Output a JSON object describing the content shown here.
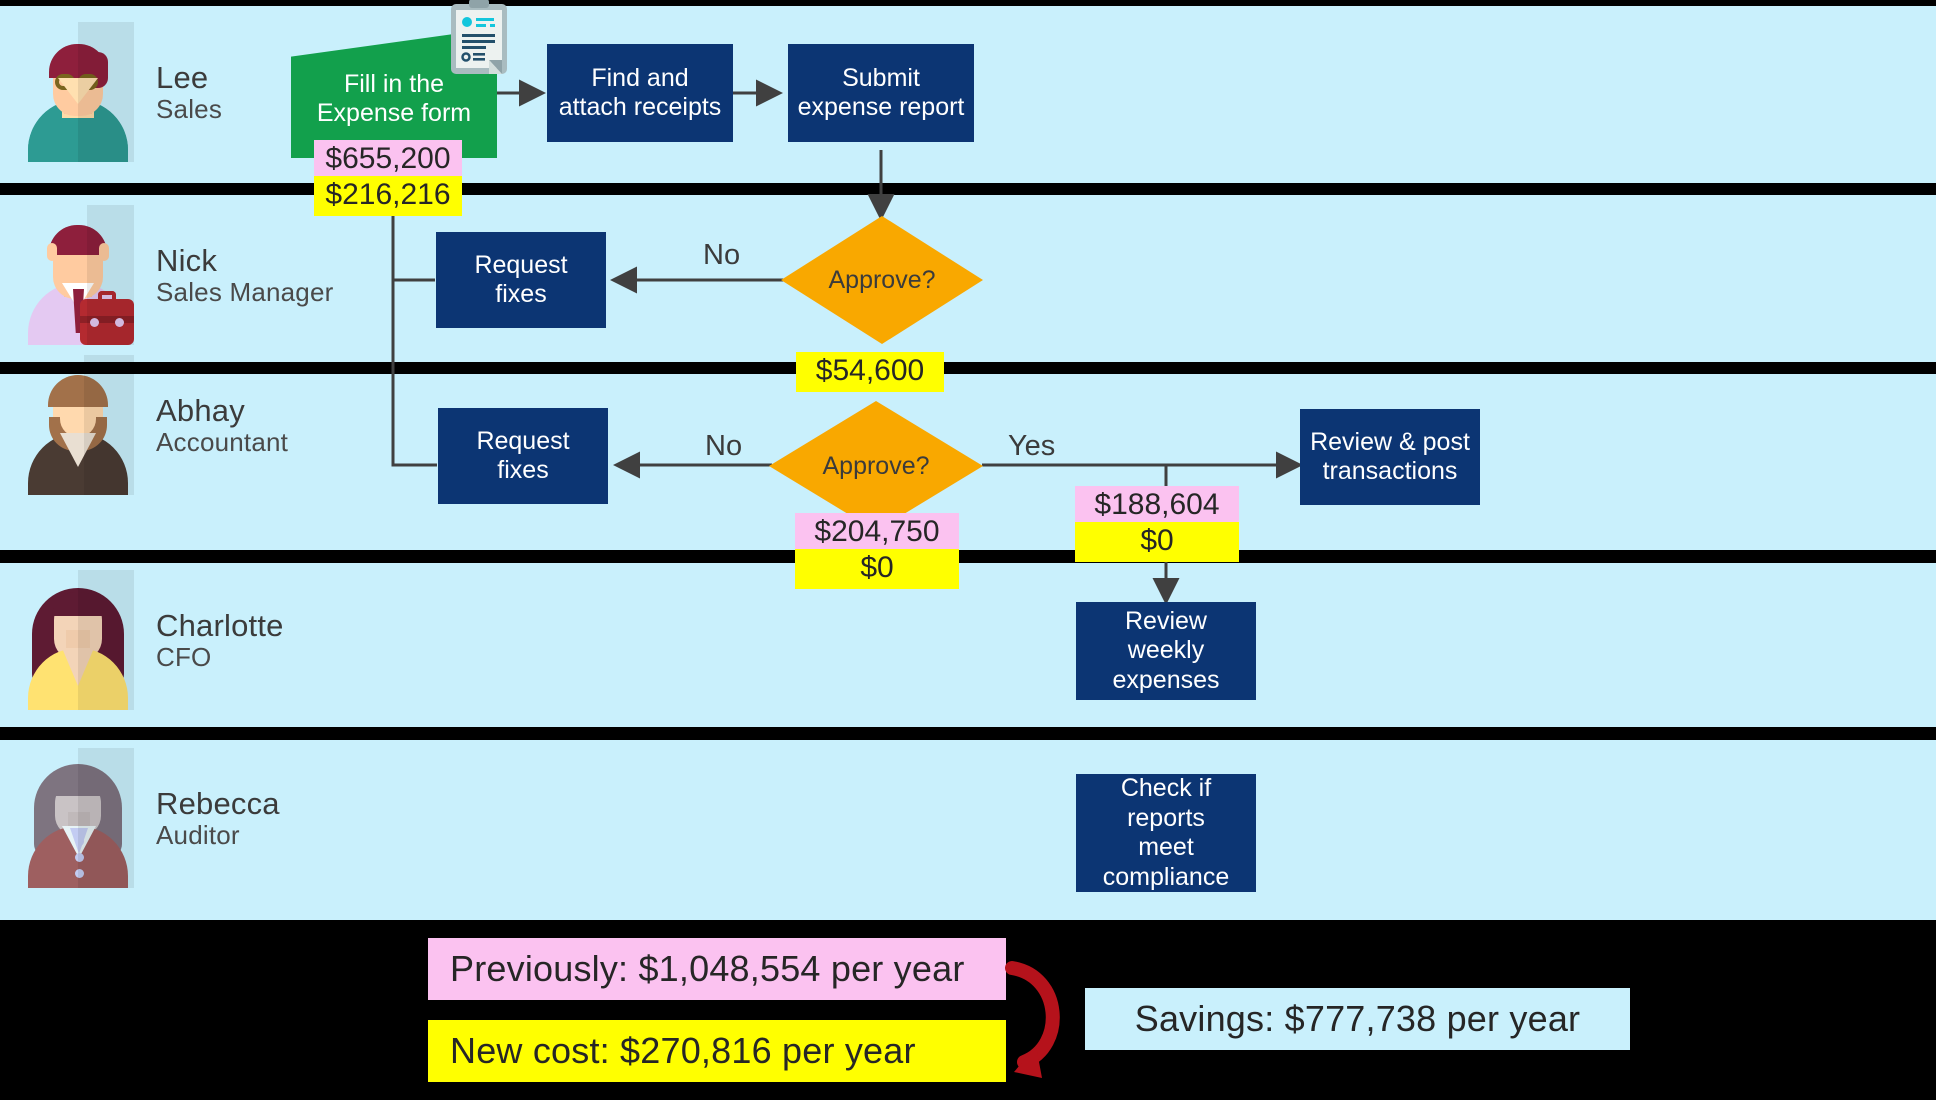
{
  "title": "Expense report process — cost comparison swimlane",
  "colors": {
    "lane_bg": "#C9F0FC",
    "lane_divider": "#000000",
    "process_box": "#0C3573",
    "start_box": "#12A04C",
    "decision": "#F9A800",
    "old_cost_tag": "#FBC2F0",
    "new_cost_tag": "#FFFF00",
    "arrow_red": "#B5121B",
    "connector": "#404040"
  },
  "lanes": [
    {
      "name": "Lee",
      "role": "Sales"
    },
    {
      "name": "Nick",
      "role": "Sales Manager"
    },
    {
      "name": "Abhay",
      "role": "Accountant"
    },
    {
      "name": "Charlotte",
      "role": "CFO"
    },
    {
      "name": "Rebecca",
      "role": "Auditor"
    }
  ],
  "nodes": {
    "fill_form": "Fill in the\nExpense form",
    "fill_form_l1": "Fill in the",
    "fill_form_l2": "Expense form",
    "find_receipts": "Find and\nattach receipts",
    "find_receipts_l1": "Find and",
    "find_receipts_l2": "attach receipts",
    "submit_report_l1": "Submit",
    "submit_report_l2": "expense report",
    "approve_nick": "Approve?",
    "request_fixes_nick_l1": "Request",
    "request_fixes_nick_l2": "fixes",
    "approve_abhay": "Approve?",
    "request_fixes_abhay_l1": "Request",
    "request_fixes_abhay_l2": "fixes",
    "review_post_l1": "Review & post",
    "review_post_l2": "transactions",
    "review_weekly_l1": "Review weekly",
    "review_weekly_l2": "expenses",
    "compliance_l1": "Check if",
    "compliance_l2": "reports",
    "compliance_l3": "meet",
    "compliance_l4": "compliance"
  },
  "edge_labels": {
    "nick_no": "No",
    "abhay_no": "No",
    "abhay_yes": "Yes"
  },
  "cost_tags": {
    "fill_form_old": "$655,200",
    "fill_form_new": "$216,216",
    "nick_approve_new": "$54,600",
    "abhay_approve_old": "$204,750",
    "abhay_approve_new": "$0",
    "post_old": "$188,604",
    "post_new": "$0"
  },
  "summary": {
    "previously": "Previously: $1,048,554 per year",
    "new_cost": "New cost: $270,816 per year",
    "savings": "Savings: $777,738 per year"
  },
  "chart_data": {
    "type": "table",
    "title": "Expense process cost per activity (old vs. new)",
    "categories": [
      "Fill in the Expense form",
      "Approve? (Sales Manager)",
      "Approve? (Accountant)",
      "Review & post transactions"
    ],
    "series": [
      {
        "name": "Previously",
        "values": [
          655200,
          0,
          204750,
          188604
        ]
      },
      {
        "name": "New cost",
        "values": [
          216216,
          54600,
          0,
          0
        ]
      }
    ],
    "totals": {
      "previously": 1048554,
      "new_cost": 270816,
      "savings": 777738
    },
    "unit": "USD per year"
  }
}
